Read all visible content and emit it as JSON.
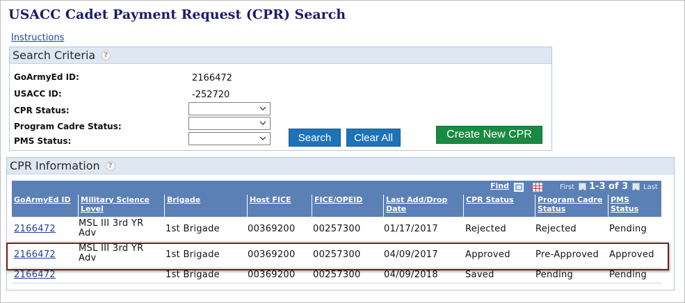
{
  "page": {
    "title": "USACC Cadet Payment Request (CPR) Search"
  },
  "instructions_link": "Instructions",
  "search_criteria": {
    "header": "Search Criteria",
    "help_glyph": "?",
    "fields": {
      "goarmyed_id": {
        "label": "GoArmyEd ID:",
        "value": "2166472"
      },
      "usacc_id": {
        "label": "USACC ID:",
        "value": "-252720"
      },
      "cpr_status": {
        "label": "CPR Status:",
        "value": ""
      },
      "program_cadre_status": {
        "label": "Program Cadre Status:",
        "value": ""
      },
      "pms_status": {
        "label": "PMS Status:",
        "value": ""
      }
    },
    "buttons": {
      "search": "Search",
      "clear_all": "Clear All",
      "create_new": "Create New CPR"
    }
  },
  "cpr_information": {
    "header": "CPR Information",
    "help_glyph": "?",
    "toolbar": {
      "find": "Find",
      "first": "First",
      "range": "1-3 of 3",
      "last": "Last"
    },
    "columns": [
      "GoArmyEd ID",
      "Military Science Level",
      "Brigade",
      "Host FICE",
      "FICE/OPEID",
      "Last Add/Drop Date",
      "CPR Status",
      "Program Cadre Status",
      "PMS Status"
    ],
    "rows": [
      [
        "2166472",
        "MSL III 3rd YR Adv",
        "1st Brigade",
        "00369200",
        "00257300",
        "01/17/2017",
        "Rejected",
        "Rejected",
        "Pending"
      ],
      [
        "2166472",
        "MSL III 3rd YR Adv",
        "1st Brigade",
        "00369200",
        "00257300",
        "04/09/2017",
        "Approved",
        "Pre-Approved",
        "Approved"
      ],
      [
        "2166472",
        "",
        "1st Brigade",
        "00369200",
        "00257300",
        "04/09/2018",
        "Saved",
        "Pending",
        "Pending"
      ]
    ]
  },
  "colors": {
    "title": "#1b1b6b",
    "section_header_bg": "#dfe7f3",
    "grid_header_bg": "#5b80b5",
    "button_blue": "#1e73b8",
    "button_green": "#1a8a43",
    "highlight": "#7b1a1a",
    "link": "#1f3fa8"
  },
  "icons": [
    "help-icon",
    "chevron-down-icon",
    "grid-view-icon",
    "download-icon",
    "previous-arrow-icon",
    "next-arrow-icon"
  ]
}
